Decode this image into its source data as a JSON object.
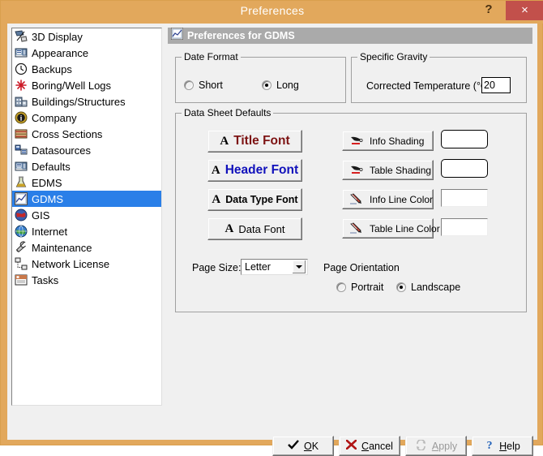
{
  "window": {
    "title": "Preferences",
    "help_button": "?",
    "close_button": "×"
  },
  "sidebar": {
    "items": [
      {
        "label": "3D Display",
        "icon": "3d-display-icon",
        "selected": false
      },
      {
        "label": "Appearance",
        "icon": "appearance-icon",
        "selected": false
      },
      {
        "label": "Backups",
        "icon": "clock-icon",
        "selected": false
      },
      {
        "label": "Boring/Well Logs",
        "icon": "red-star-icon",
        "selected": false
      },
      {
        "label": "Buildings/Structures",
        "icon": "building-icon",
        "selected": false
      },
      {
        "label": "Company",
        "icon": "info-badge-icon",
        "selected": false
      },
      {
        "label": "Cross Sections",
        "icon": "cross-section-icon",
        "selected": false
      },
      {
        "label": "Datasources",
        "icon": "datasource-icon",
        "selected": false
      },
      {
        "label": "Defaults",
        "icon": "defaults-icon",
        "selected": false
      },
      {
        "label": "EDMS",
        "icon": "flask-icon",
        "selected": false
      },
      {
        "label": "GDMS",
        "icon": "chart-icon",
        "selected": true
      },
      {
        "label": "GIS",
        "icon": "globe-red-icon",
        "selected": false
      },
      {
        "label": "Internet",
        "icon": "globe-blue-icon",
        "selected": false
      },
      {
        "label": "Maintenance",
        "icon": "wrench-icon",
        "selected": false
      },
      {
        "label": "Network License",
        "icon": "network-icon",
        "selected": false
      },
      {
        "label": "Tasks",
        "icon": "tasks-icon",
        "selected": false
      }
    ]
  },
  "panel": {
    "header_title": "Preferences for GDMS",
    "header_icon": "chart-icon",
    "date_format": {
      "legend": "Date Format",
      "options": [
        {
          "label": "Short",
          "checked": false
        },
        {
          "label": "Long",
          "checked": true
        }
      ]
    },
    "specific_gravity": {
      "legend": "Specific Gravity",
      "field_label": "Corrected Temperature (°C):",
      "field_value": "20"
    },
    "data_sheet_defaults": {
      "legend": "Data Sheet Defaults",
      "font_buttons": [
        {
          "label": "Title Font",
          "style": "t-title",
          "color": "#7d1313"
        },
        {
          "label": "Header Font",
          "style": "t-header",
          "color": "#1111bb"
        },
        {
          "label": "Data Type Font",
          "style": "t-dtype",
          "color": "#000000"
        },
        {
          "label": "Data Font",
          "style": "t-data",
          "color": "#000000"
        }
      ],
      "color_buttons": [
        {
          "label": "Info Shading",
          "icon": "brush-icon",
          "swatch": "round",
          "swatch_color": "#ffffff"
        },
        {
          "label": "Table Shading",
          "icon": "brush-icon",
          "swatch": "round",
          "swatch_color": "#ffffff"
        },
        {
          "label": "Info Line Color",
          "icon": "pencil-icon",
          "swatch": "sunken",
          "swatch_color": "#ffffff"
        },
        {
          "label": "Table Line Color",
          "icon": "pencil-icon",
          "swatch": "sunken",
          "swatch_color": "#ffffff"
        }
      ],
      "page_size_label": "Page Size:",
      "page_size_value": "Letter",
      "page_orientation_label": "Page Orientation",
      "orientation_options": [
        {
          "label": "Portrait",
          "checked": false
        },
        {
          "label": "Landscape",
          "checked": true
        }
      ]
    }
  },
  "footer": {
    "buttons": [
      {
        "pre": "",
        "accel": "O",
        "post": "K",
        "icon": "check-icon",
        "enabled": true
      },
      {
        "pre": "",
        "accel": "C",
        "post": "ancel",
        "icon": "cross-icon",
        "enabled": true
      },
      {
        "pre": "",
        "accel": "A",
        "post": "pply",
        "icon": "refresh-icon",
        "enabled": false
      },
      {
        "pre": "",
        "accel": "H",
        "post": "elp",
        "icon": "question-icon",
        "enabled": true
      }
    ]
  },
  "colors": {
    "titlebar": "#e2a85c",
    "close": "#c2504b",
    "selection": "#2a7fe8",
    "panel_header": "#aaaaaa",
    "face": "#f0f0f0"
  }
}
